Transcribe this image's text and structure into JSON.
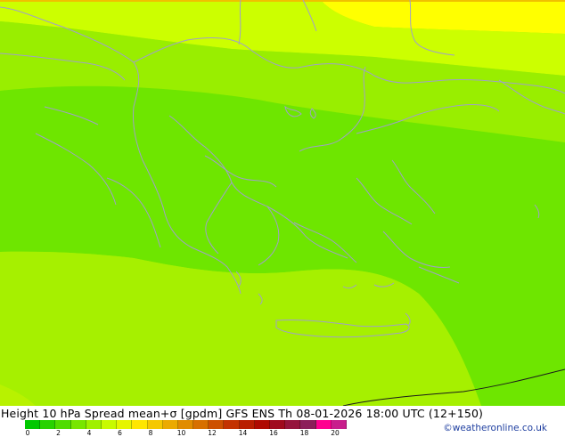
{
  "title": "Height 10 hPa Spread mean+σ [gpdm] GFS ENS   Th 08-01-2026 18:00 UTC (12+150)",
  "credit": "©weatheronline.co.uk",
  "colorbar": {
    "tick_labels": [
      "0",
      "2",
      "4",
      "6",
      "8",
      "10",
      "12",
      "14",
      "16",
      "18",
      "20"
    ],
    "colors": [
      "#00c800",
      "#28d200",
      "#50dc00",
      "#78e600",
      "#a0f000",
      "#c8fa00",
      "#e6f500",
      "#ffe600",
      "#f5c800",
      "#ebaa00",
      "#e18c00",
      "#d77000",
      "#cd5000",
      "#c33200",
      "#b91e00",
      "#af0a00",
      "#a00a1e",
      "#96143c",
      "#8c1e5a",
      "#ff0090",
      "#c81e8c"
    ]
  },
  "map": {
    "band_colors": [
      "#ffff00",
      "#ccff00",
      "#aaf000",
      "#96eb00",
      "#6ee600"
    ]
  }
}
